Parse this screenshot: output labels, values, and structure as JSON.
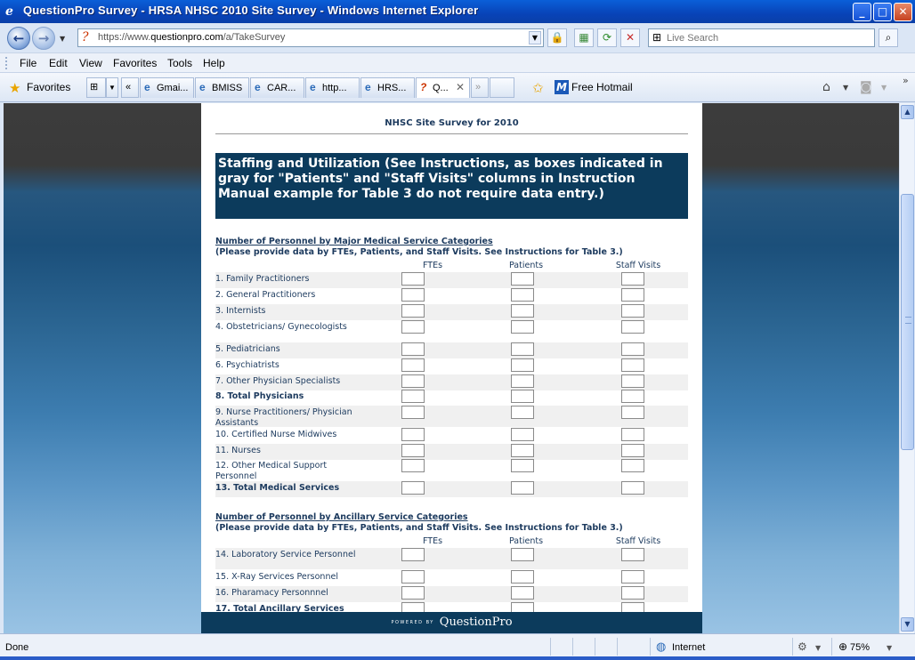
{
  "window": {
    "title": "QuestionPro Survey - HRSA NHSC 2010 Site Survey - Windows Internet Explorer",
    "minimize": "_",
    "maximize": "□",
    "close": "✕"
  },
  "address": {
    "url_prefix": "https://www.",
    "url_domain": "questionpro.com",
    "url_path": "/a/TakeSurvey",
    "search_placeholder": "Live Search"
  },
  "menu": [
    "File",
    "Edit",
    "View",
    "Favorites",
    "Tools",
    "Help"
  ],
  "favbar": {
    "favorites_label": "Favorites",
    "tabs": [
      {
        "label": "Gmai..."
      },
      {
        "label": "BMISS"
      },
      {
        "label": "CAR..."
      },
      {
        "label": "http..."
      },
      {
        "label": "HRS..."
      },
      {
        "label": "Q..."
      }
    ],
    "hotmail_label": "Free Hotmail"
  },
  "survey": {
    "title": "NHSC Site Survey for 2010",
    "section_banner": "Staffing and Utilization (See Instructions, as boxes indicated in gray for \"Patients\" and \"Staff Visits\" columns in Instruction Manual example for Table 3 do not require data entry.)",
    "columns": [
      "FTEs",
      "Patients",
      "Staff Visits"
    ],
    "groups": [
      {
        "heading": "Number of Personnel by Major Medical Service Categories",
        "subheading": "(Please provide data by FTEs, Patients, and Staff Visits. See Instructions for Table 3.)",
        "rows": [
          {
            "label": "1. Family Practitioners"
          },
          {
            "label": "2. General Practitioners"
          },
          {
            "label": "3. Internists"
          },
          {
            "label": "4. Obstetricians/ Gynecologists"
          },
          {
            "label": "5. Pediatricians"
          },
          {
            "label": "6. Psychiatrists"
          },
          {
            "label": "7. Other Physician Specialists"
          },
          {
            "label": "8. Total Physicians"
          },
          {
            "label": "9. Nurse Practitioners/ Physician Assistants"
          },
          {
            "label": "10. Certified Nurse Midwives"
          },
          {
            "label": "11. Nurses"
          },
          {
            "label": "12. Other Medical Support Personnel"
          },
          {
            "label": "13. Total Medical Services"
          }
        ]
      },
      {
        "heading": "Number of Personnel by Ancillary Service Categories",
        "subheading": "(Please provide data by FTEs, Patients, and Staff Visits. See Instructions for Table 3.)",
        "rows": [
          {
            "label": "14. Laboratory Service Personnel"
          },
          {
            "label": "15. X-Ray Services Personnel"
          },
          {
            "label": "16. Pharamacy Personnnel"
          },
          {
            "label": "17. Total Ancillary Services"
          }
        ]
      }
    ],
    "footer_powered": "POWERED BY",
    "footer_brand": "QuestionPro"
  },
  "status": {
    "text": "Done",
    "zone": "Internet",
    "zoom": "75%"
  }
}
